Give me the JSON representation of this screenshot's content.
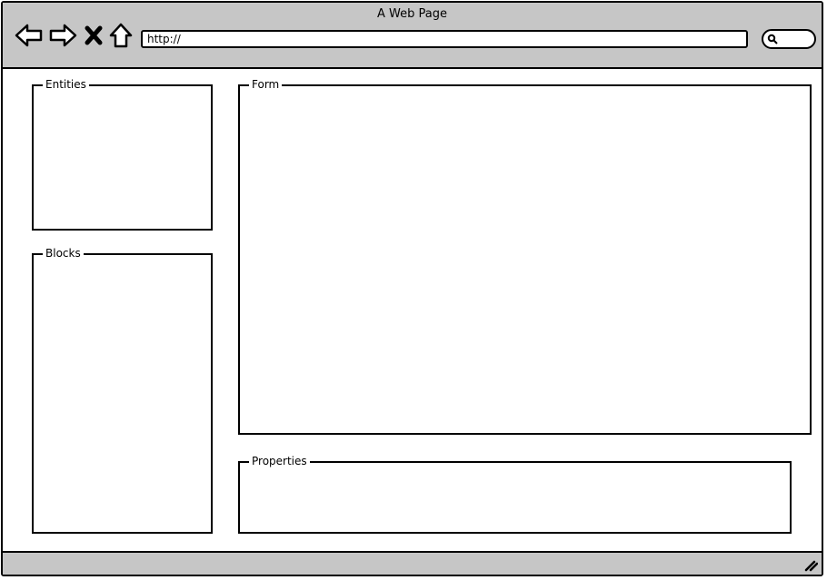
{
  "window": {
    "title": "A Web Page"
  },
  "toolbar": {
    "url_value": "http://",
    "icons": [
      "back-arrow-icon",
      "forward-arrow-icon",
      "close-x-icon",
      "home-icon",
      "search-icon"
    ]
  },
  "panels": {
    "entities": {
      "label": "Entities"
    },
    "blocks": {
      "label": "Blocks"
    },
    "form": {
      "label": "Form"
    },
    "properties": {
      "label": "Properties"
    }
  },
  "colors": {
    "chrome": "#c6c6c6",
    "border": "#000000",
    "background": "#ffffff"
  }
}
